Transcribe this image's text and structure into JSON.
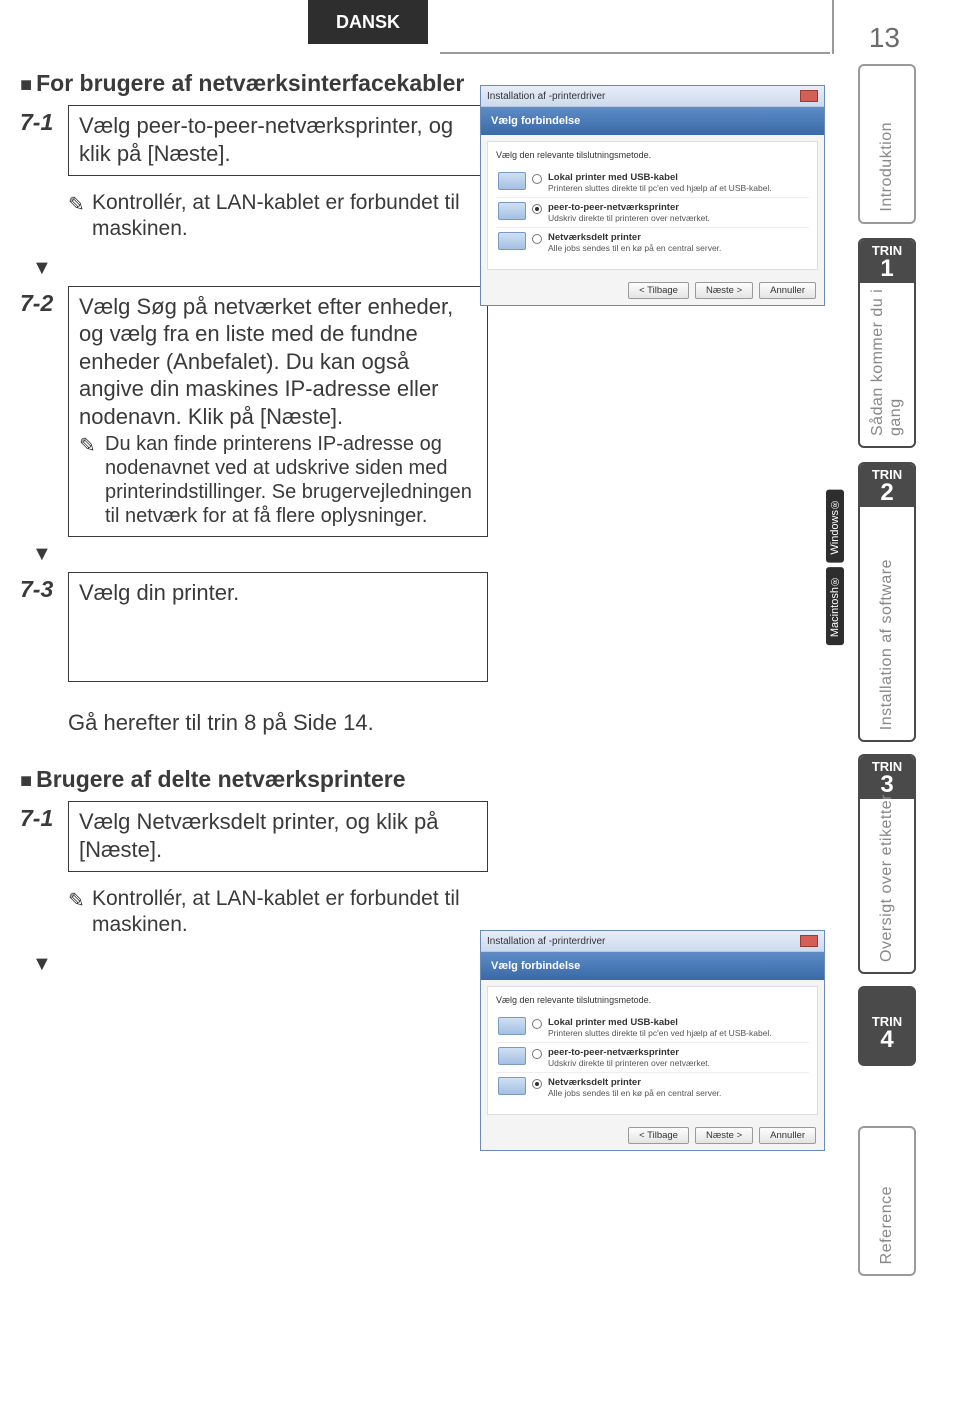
{
  "page": {
    "lang_tab": "DANSK",
    "number": "13"
  },
  "sectionA": {
    "heading": "For brugere af netværksinterfacekabler",
    "step71_num": "7-1",
    "step71_text": "Vælg peer-to-peer-netværksprinter, og klik på [Næste].",
    "noteA": "Kontrollér, at LAN-kablet er forbundet til maskinen.",
    "step72_num": "7-2",
    "step72_text": "Vælg Søg på netværket efter enheder, og vælg fra en liste med de fundne enheder (Anbefalet). Du kan også angive din maskines IP-adresse eller nodenavn. Klik på [Næste].",
    "step72_sub": "Du kan finde printerens IP-adresse og nodenavnet ved at udskrive siden med printerindstillinger. Se brugervejledningen til netværk for at få flere oplysninger.",
    "step73_num": "7-3",
    "step73_text": "Vælg din printer.",
    "goto": "Gå herefter til trin 8 på Side 14."
  },
  "sectionB": {
    "heading": "Brugere af delte netværksprintere",
    "step71_num": "7-1",
    "step71_text": "Vælg Netværksdelt printer, og klik på [Næste].",
    "noteB": "Kontrollér, at LAN-kablet er forbundet til maskinen."
  },
  "dialog": {
    "title": "Installation af -printerdriver",
    "banner": "Vælg forbindelse",
    "instr": "Vælg den relevante tilslutningsmetode.",
    "opt1_label": "Lokal printer med USB-kabel",
    "opt1_sub": "Printeren sluttes direkte til pc'en ved hjælp af et USB-kabel.",
    "opt2_label": "peer-to-peer-netværksprinter",
    "opt2_sub": "Udskriv direkte til printeren over netværket.",
    "opt3_label": "Netværksdelt printer",
    "opt3_sub": "Alle jobs sendes til en kø på en central server.",
    "btn_back": "< Tilbage",
    "btn_next": "Næste >",
    "btn_cancel": "Annuller"
  },
  "rail": {
    "intro": "Introduktion",
    "trin_label": "TRIN",
    "trin1_num": "1",
    "trin1_text": "Sådan kommer du i gang",
    "trin2_num": "2",
    "trin2_text": "Installation af software",
    "trin2_win": "Windows®",
    "trin2_mac": "Macintosh®",
    "trin3_num": "3",
    "trin3_text": "Oversigt over etiketter",
    "trin4_num": "4",
    "ref": "Reference"
  }
}
